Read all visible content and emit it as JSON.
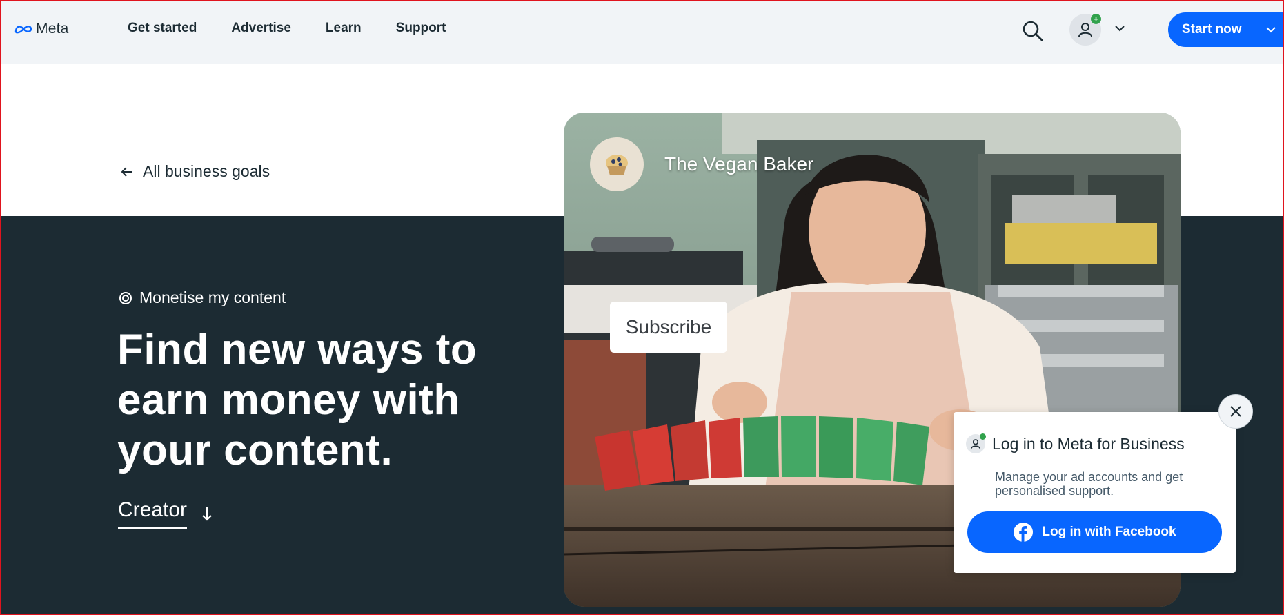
{
  "header": {
    "logo_text": "Meta",
    "nav": [
      "Get started",
      "Advertise",
      "Learn",
      "Support"
    ],
    "start_label": "Start now",
    "account_badge": "+"
  },
  "back_link": "All business goals",
  "goal_label": "Monetise my content",
  "headline": "Find new ways to earn money with your content.",
  "creator_label": "Creator",
  "hero": {
    "profile_name": "The Vegan Baker",
    "subscribe_label": "Subscribe"
  },
  "popup": {
    "title": "Log in to Meta for Business",
    "description": "Manage your ad accounts and get personalised support.",
    "button_label": "Log in with Facebook"
  },
  "colors": {
    "accent": "#0866ff",
    "dark_band": "#1c2b33",
    "header_bg": "#f1f4f7",
    "status_green": "#31a24c"
  }
}
